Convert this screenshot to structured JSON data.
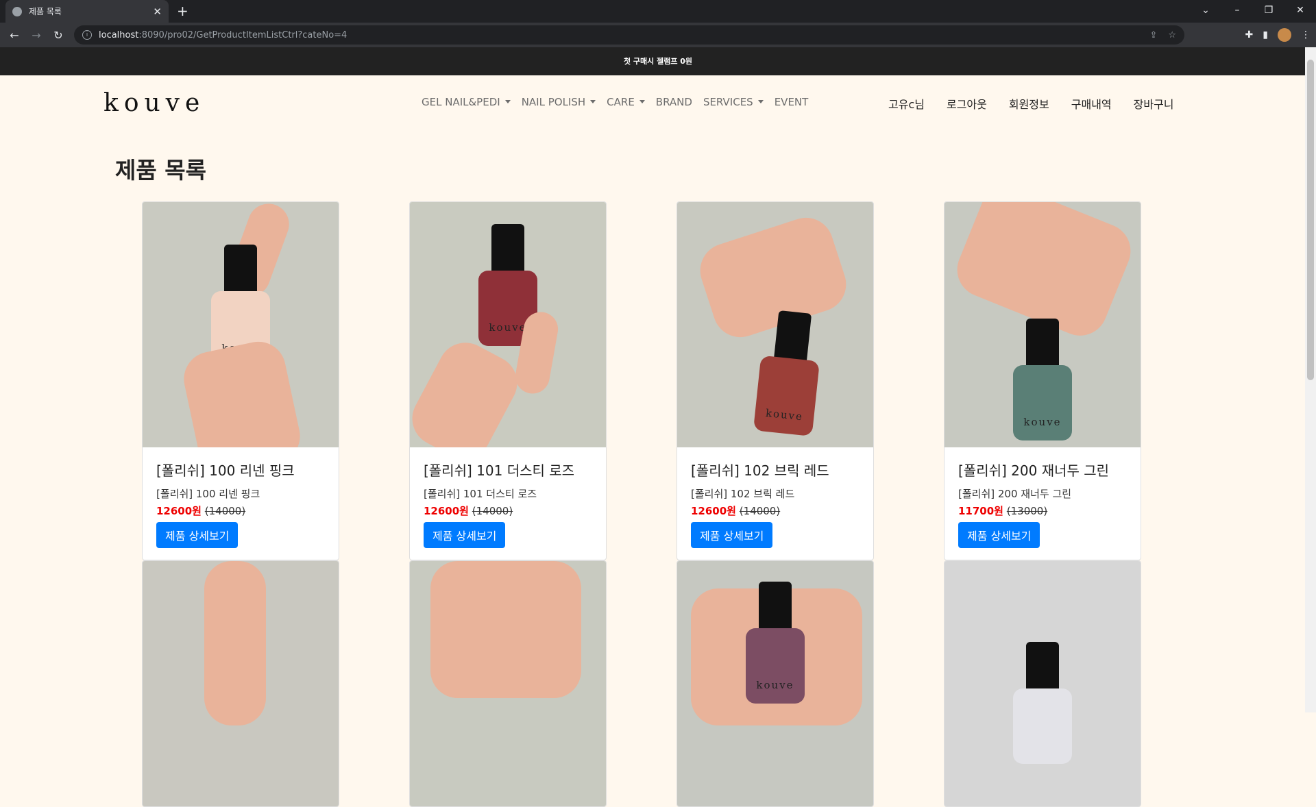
{
  "browser": {
    "tab_title": "제품 목록",
    "url_host": "localhost",
    "url_path": ":8090/pro02/GetProductItemListCtrl?cateNo=4"
  },
  "banner": {
    "text": "첫 구매시 젤램프 0원"
  },
  "nav": {
    "logo": "kouve",
    "menu": [
      "GEL NAIL&PEDI",
      "NAIL POLISH",
      "CARE",
      "BRAND",
      "SERVICES",
      "EVENT"
    ],
    "user_menu": [
      "고유c님",
      "로그아웃",
      "회원정보",
      "구매내역",
      "장바구니"
    ]
  },
  "page": {
    "title": "제품 목록"
  },
  "products": [
    {
      "name": "[폴리쉬] 100 리넨 핑크",
      "desc": "[폴리쉬] 100 리넨 핑크",
      "sale_price": "12600원",
      "orig_price": "(14000)",
      "button": "제품 상세보기",
      "bg": "#c9cac1",
      "polish": "#f2d3c2"
    },
    {
      "name": "[폴리쉬] 101 더스티 로즈",
      "desc": "[폴리쉬] 101 더스티 로즈",
      "sale_price": "12600원",
      "orig_price": "(14000)",
      "button": "제품 상세보기",
      "bg": "#c9cbc0",
      "polish": "#8f3038"
    },
    {
      "name": "[폴리쉬] 102 브릭 레드",
      "desc": "[폴리쉬] 102 브릭 레드",
      "sale_price": "12600원",
      "orig_price": "(14000)",
      "button": "제품 상세보기",
      "bg": "#c8c9c0",
      "polish": "#9c3f38"
    },
    {
      "name": "[폴리쉬] 200 재너두 그린",
      "desc": "[폴리쉬] 200 재너두 그린",
      "sale_price": "11700원",
      "orig_price": "(13000)",
      "button": "제품 상세보기",
      "bg": "#c7c9c1",
      "polish": "#5a7f76"
    }
  ],
  "more_products_bg": [
    "#c9c8c0",
    "#c8cac0",
    "#c6c8c1",
    "#d6d6d6"
  ]
}
